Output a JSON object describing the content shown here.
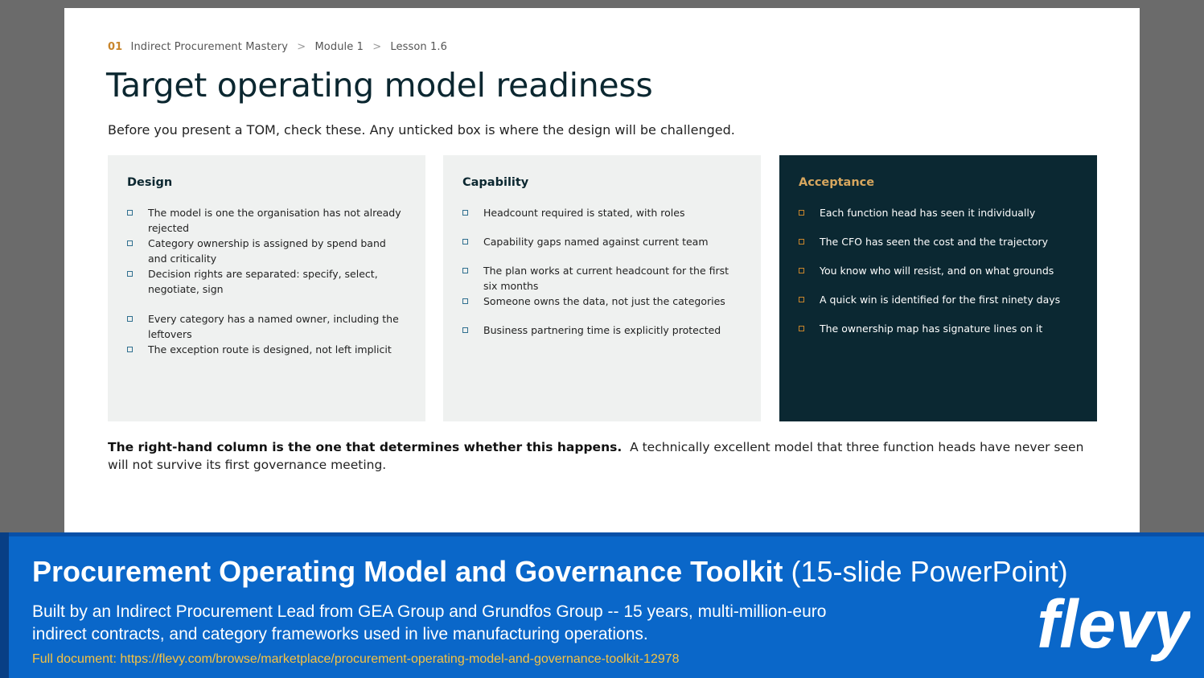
{
  "breadcrumb": {
    "number": "01",
    "items": [
      "Indirect Procurement Mastery",
      "Module 1",
      "Lesson 1.6"
    ],
    "separator": ">"
  },
  "title": "Target operating model readiness",
  "intro": "Before you present a TOM, check these. Any unticked box is where the design will be challenged.",
  "columns": [
    {
      "heading": "Design",
      "items": [
        "The model is one the organisation has not already rejected",
        "Category ownership is assigned by spend band and criticality",
        "Decision rights are separated: specify, select, negotiate, sign",
        "Every category has a named owner, including the leftovers",
        "The exception route is designed, not left implicit"
      ]
    },
    {
      "heading": "Capability",
      "items": [
        "Headcount required is stated, with roles",
        "Capability gaps named against current team",
        "The plan works at current headcount for the first six months",
        "Someone owns the data, not just the categories",
        "Business partnering time is explicitly protected"
      ]
    },
    {
      "heading": "Acceptance",
      "items": [
        "Each function head has seen it individually",
        "The CFO has seen the cost and the trajectory",
        "You know who will resist, and on what grounds",
        "A quick win is identified for the first ninety days",
        "The ownership map has signature lines on it"
      ]
    }
  ],
  "note": {
    "bold": "The right-hand column is the one that determines whether this happens.",
    "text": "A technically excellent model that three function heads have never seen will not survive its first governance meeting."
  },
  "footer": {
    "title": "Procurement Operating Model and Governance Toolkit",
    "title_suffix": "(15-slide PowerPoint)",
    "description": "Built by an Indirect Procurement Lead from GEA Group and Grundfos Group -- 15 years, multi-million-euro indirect contracts, and category frameworks used in live manufacturing operations.",
    "link": "Full document: https://flevy.com/browse/marketplace/procurement-operating-model-and-governance-toolkit-12978",
    "logo": "flevy"
  },
  "colors": {
    "accent_orange": "#c8852b",
    "dark_panel": "#0b2832",
    "light_panel": "#eff1f0",
    "footer_blue": "#0a67c9",
    "link_yellow": "#f5c242"
  }
}
